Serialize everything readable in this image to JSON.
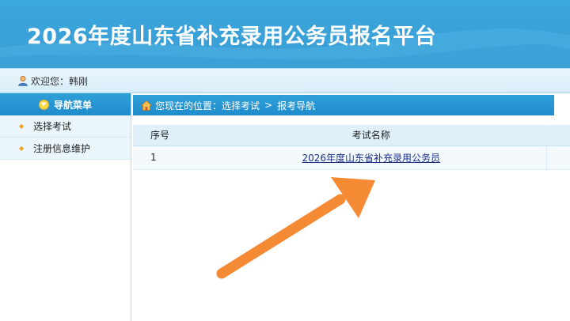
{
  "header": {
    "title": "2026年度山东省补充录用公务员报名平台"
  },
  "welcome": {
    "text": "欢迎您：韩刚"
  },
  "sidebar": {
    "title": "导航菜单",
    "items": [
      {
        "label": "选择考试"
      },
      {
        "label": "注册信息维护"
      }
    ]
  },
  "breadcrumb": {
    "prefix": "您现在的位置：",
    "items": [
      "选择考试",
      "报考导航"
    ],
    "separator": ">"
  },
  "table": {
    "headers": [
      "序号",
      "考试名称"
    ],
    "rows": [
      {
        "no": "1",
        "name": "2026年度山东省补充录用公务员"
      }
    ]
  },
  "colors": {
    "banner": "#3aa8dc",
    "accent": "#1f8ccb",
    "annotation_arrow": "#f58a35"
  },
  "icons": [
    "user-icon",
    "chevron-down-icon",
    "home-icon",
    "bullet-icon",
    "annotation-arrow"
  ]
}
